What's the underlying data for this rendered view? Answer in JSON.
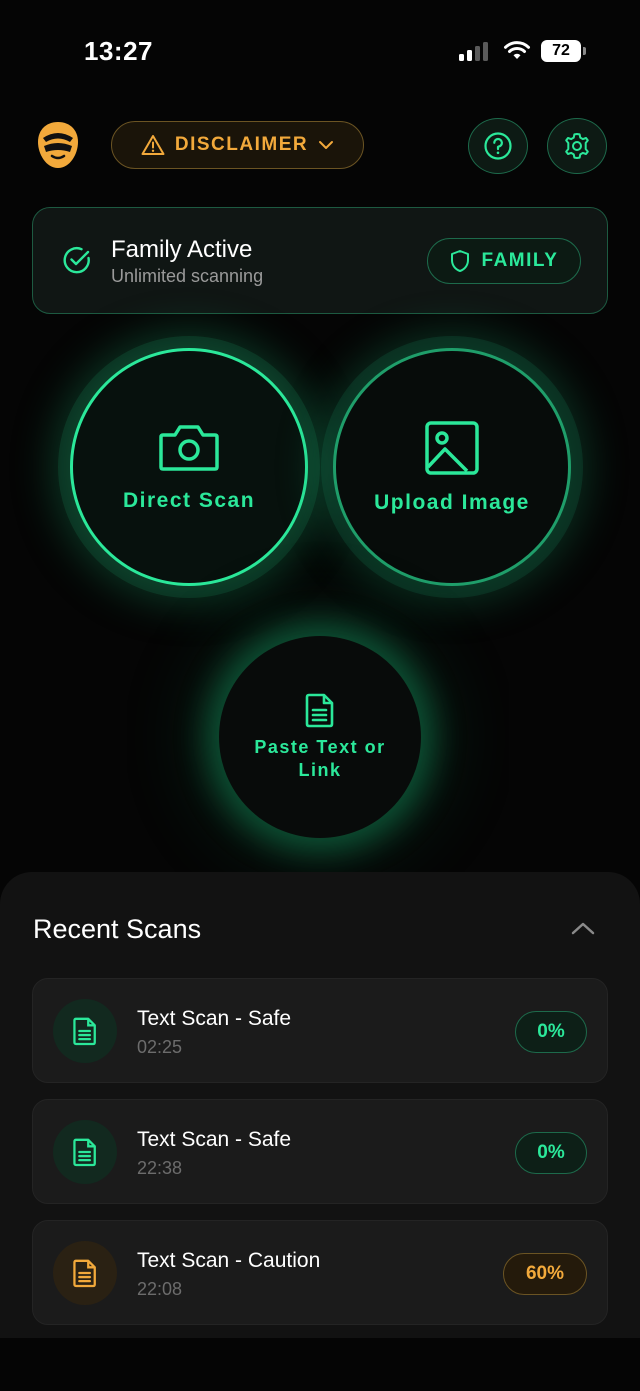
{
  "status": {
    "time": "13:27",
    "battery": "72"
  },
  "header": {
    "disclaimer_label": "DISCLAIMER"
  },
  "plan": {
    "title": "Family Active",
    "subtitle": "Unlimited scanning",
    "badge": "FAMILY"
  },
  "actions": {
    "direct_scan": "Direct Scan",
    "upload_image": "Upload Image",
    "paste_text": "Paste Text or Link"
  },
  "recent": {
    "title": "Recent Scans",
    "items": [
      {
        "title": "Text Scan - Safe",
        "time": "02:25",
        "score": "0%",
        "status": "safe"
      },
      {
        "title": "Text Scan - Safe",
        "time": "22:38",
        "score": "0%",
        "status": "safe"
      },
      {
        "title": "Text Scan - Caution",
        "time": "22:08",
        "score": "60%",
        "status": "caution"
      }
    ]
  },
  "colors": {
    "accent": "#2be89a",
    "warning": "#f2a93b",
    "background": "#050505"
  }
}
